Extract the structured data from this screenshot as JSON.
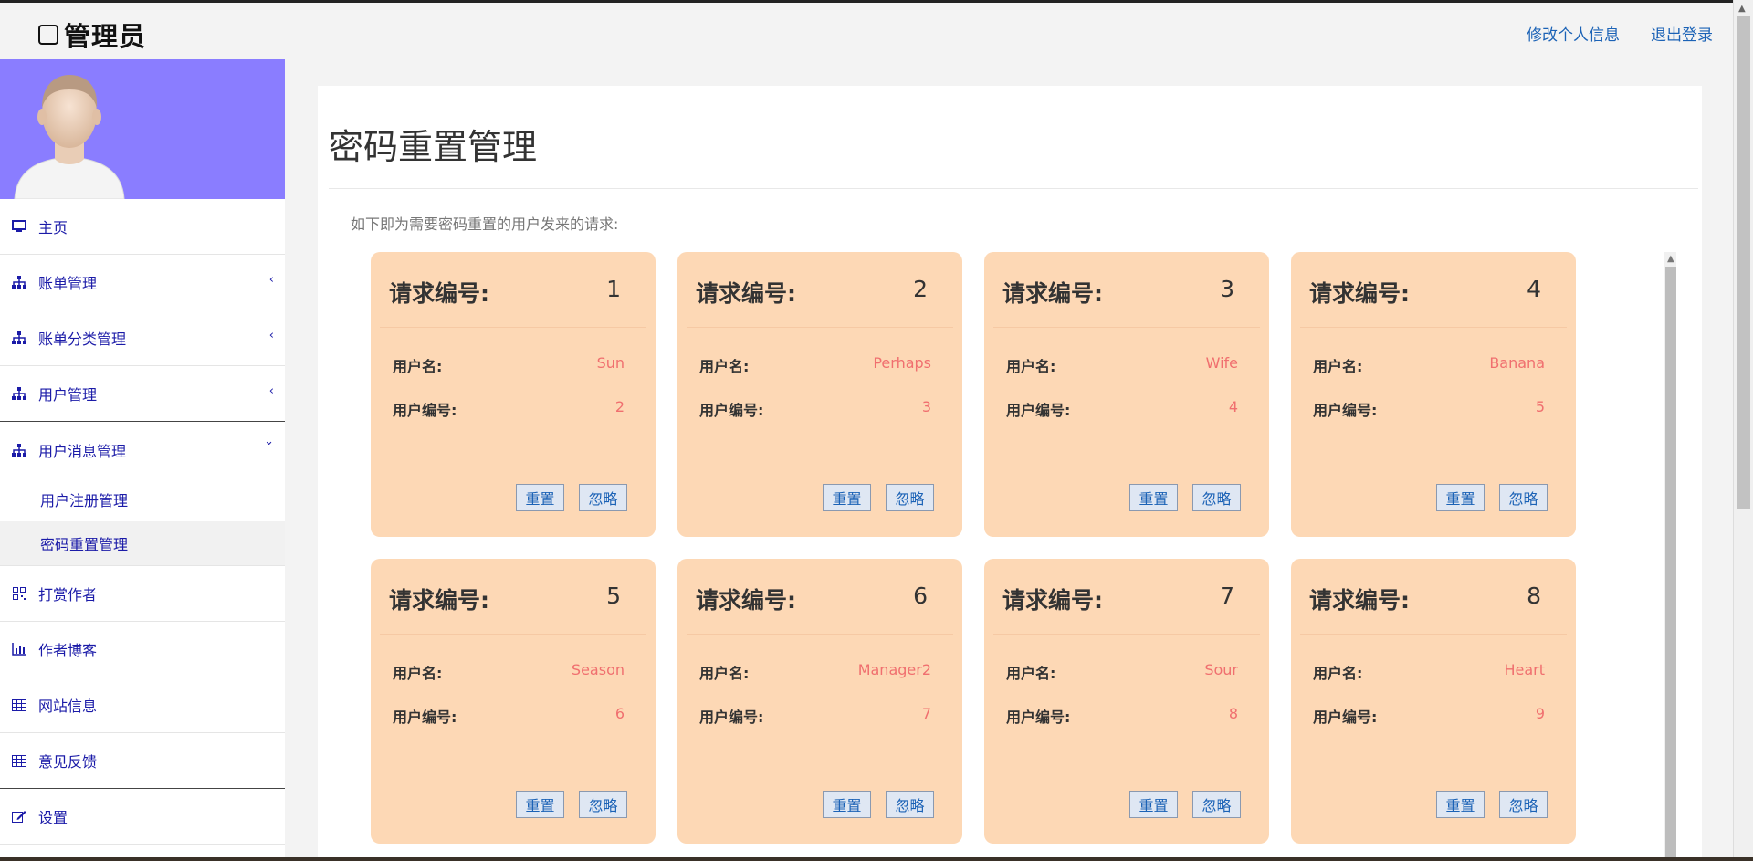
{
  "header": {
    "brand": "管理员",
    "edit_profile": "修改个人信息",
    "logout": "退出登录"
  },
  "sidebar": {
    "items": [
      {
        "label": "主页",
        "icon": "monitor-icon",
        "caret": ""
      },
      {
        "label": "账单管理",
        "icon": "sitemap-icon",
        "caret": "‹"
      },
      {
        "label": "账单分类管理",
        "icon": "sitemap-icon",
        "caret": "‹"
      },
      {
        "label": "用户管理",
        "icon": "sitemap-icon",
        "caret": "‹"
      },
      {
        "label": "用户消息管理",
        "icon": "sitemap-icon",
        "caret": "⌄"
      },
      {
        "label": "打赏作者",
        "icon": "qrcode-icon",
        "caret": ""
      },
      {
        "label": "作者博客",
        "icon": "bar-chart-icon",
        "caret": ""
      },
      {
        "label": "网站信息",
        "icon": "table-icon",
        "caret": ""
      },
      {
        "label": "意见反馈",
        "icon": "table-icon",
        "caret": ""
      },
      {
        "label": "设置",
        "icon": "edit-icon",
        "caret": ""
      }
    ],
    "subitems": [
      {
        "label": "用户注册管理",
        "active": false
      },
      {
        "label": "密码重置管理",
        "active": true
      }
    ]
  },
  "main": {
    "title": "密码重置管理",
    "intro": "如下即为需要密码重置的用户发来的请求:",
    "card_title_label": "请求编号:",
    "username_label": "用户名:",
    "userid_label": "用户编号:",
    "reset_label": "重置",
    "ignore_label": "忽略",
    "requests": [
      {
        "id": "1",
        "username": "Sun",
        "user_id": "2"
      },
      {
        "id": "2",
        "username": "Perhaps",
        "user_id": "3"
      },
      {
        "id": "3",
        "username": "Wife",
        "user_id": "4"
      },
      {
        "id": "4",
        "username": "Banana",
        "user_id": "5"
      },
      {
        "id": "5",
        "username": "Season",
        "user_id": "6"
      },
      {
        "id": "6",
        "username": "Manager2",
        "user_id": "7"
      },
      {
        "id": "7",
        "username": "Sour",
        "user_id": "8"
      },
      {
        "id": "8",
        "username": "Heart",
        "user_id": "9"
      }
    ]
  },
  "colors": {
    "sidebar_link": "#1b1ba8",
    "header_link": "#1b62b6",
    "avatar_bg": "#8a7dff",
    "card_bg": "#fdd8b5",
    "value_text": "#f06f6f"
  }
}
